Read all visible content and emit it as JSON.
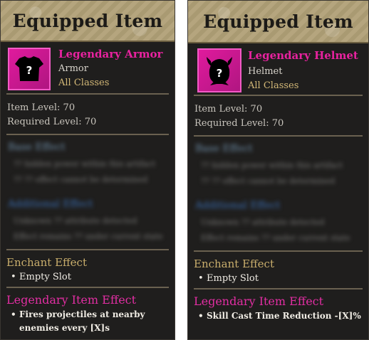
{
  "panels": [
    {
      "header_title": "Equipped Item",
      "item": {
        "name": "Legendary Armor",
        "type": "Armor",
        "classes": "All Classes",
        "icon": "armor-silhouette-icon",
        "icon_color": "#e01a9d"
      },
      "stats": {
        "item_level": "Item Level: 70",
        "required_level": "Required Level: 70"
      },
      "base_effect": {
        "title": "Base Effect",
        "lines": [
          "?? hidden power within this artifact",
          "?? ?? effect cannot be determined"
        ]
      },
      "additional_effect": {
        "title": "Additional Effect",
        "lines": [
          "Unknown ?? attribute detected",
          "Effect remains ?? under current state"
        ]
      },
      "enchant": {
        "title": "Enchant Effect",
        "slot": "Empty Slot"
      },
      "legendary": {
        "title": "Legendary Item Effect",
        "effect": "Fires projectiles at nearby enemies every [X]s"
      }
    },
    {
      "header_title": "Equipped Item",
      "item": {
        "name": "Legendary Helmet",
        "type": "Helmet",
        "classes": "All Classes",
        "icon": "horned-helmet-silhouette-icon",
        "icon_color": "#e01a9d"
      },
      "stats": {
        "item_level": "Item Level: 70",
        "required_level": "Required Level: 70"
      },
      "base_effect": {
        "title": "Base Effect",
        "lines": [
          "?? hidden power within this artifact",
          "?? ?? effect cannot be determined"
        ]
      },
      "additional_effect": {
        "title": "Additional Effect",
        "lines": [
          "Unknown ?? attribute detected",
          "Effect remains ?? under current state"
        ]
      },
      "enchant": {
        "title": "Enchant Effect",
        "slot": "Empty Slot"
      },
      "legendary": {
        "title": "Legendary Item Effect",
        "effect": "Skill Cast Time Reduction -[X]%"
      }
    }
  ]
}
